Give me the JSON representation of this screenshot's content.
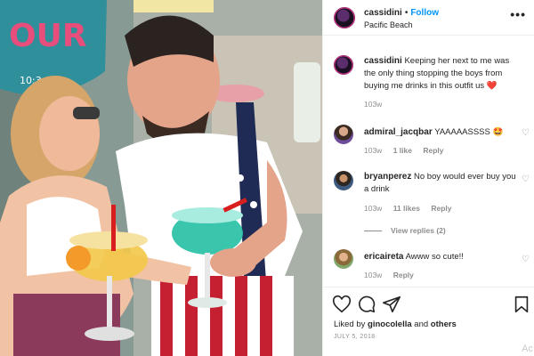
{
  "post": {
    "username": "cassidini",
    "follow_label": "Follow",
    "location": "Pacific Beach",
    "more_label": "•••"
  },
  "caption": {
    "username": "cassidini",
    "text": "Keeping her next to me was the only thing stopping the boys from buying me drinks in this outfit us ❤️",
    "age": "103w"
  },
  "comments": [
    {
      "username": "admiral_jacqbar",
      "text": "YAAAAASSSS 🤩",
      "age": "103w",
      "likes": "1 like",
      "reply_label": "Reply"
    },
    {
      "username": "bryanperez",
      "text": "No boy would ever buy you a drink",
      "age": "103w",
      "likes": "11 likes",
      "reply_label": "Reply",
      "view_replies": "View replies (2)"
    },
    {
      "username": "ericaireta",
      "text": "Awww so cute!!",
      "age": "103w",
      "reply_label": "Reply"
    }
  ],
  "footer": {
    "liked_prefix": "Liked by",
    "liked_user": "ginocolella",
    "liked_and": "and",
    "liked_others": "others",
    "date": "JULY 5, 2018"
  },
  "photo_sign": {
    "line1": "OUR",
    "line2": "10:3"
  },
  "watermark": "Ac",
  "colors": {
    "follow_blue": "#0095f6",
    "text_primary": "#262626",
    "text_secondary": "#8e8e8e",
    "heart_red": "#ed4956"
  },
  "icons": [
    "heart-icon",
    "comment-icon",
    "share-icon",
    "bookmark-icon",
    "more-icon"
  ]
}
